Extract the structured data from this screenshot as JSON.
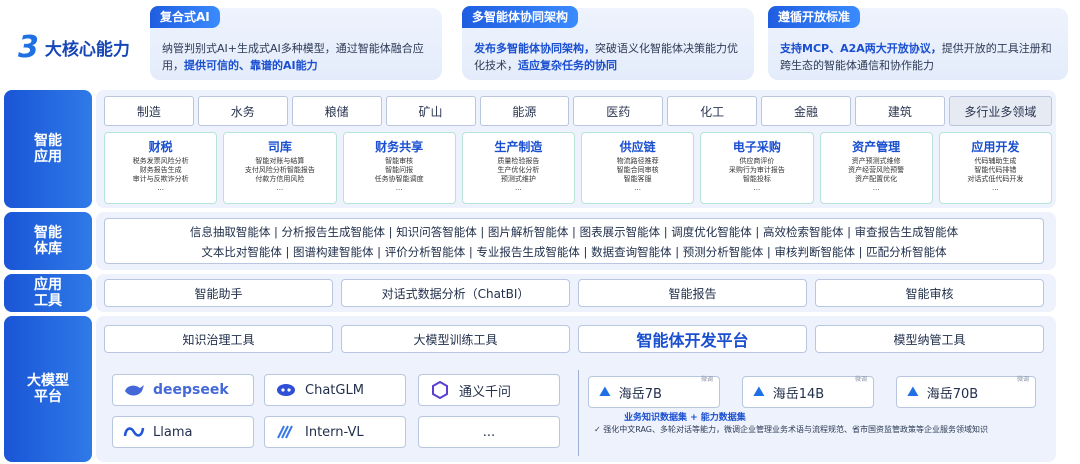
{
  "hero": {
    "number": "3",
    "label": "大核心能力"
  },
  "cards": [
    {
      "tag": "复合式AI",
      "body_plain": "纳管判别式AI+生成式AI多种模型，通过智能体融合应用，",
      "body_bold": "提供可信的、靠谱的AI能力"
    },
    {
      "tag": "多智能体协同架构",
      "body_bold_a": "发布多智能体协同架构，",
      "body_plain": "突破语义化智能体决策能力优化技术，",
      "body_bold_b": "适应复杂任务的协同"
    },
    {
      "tag": "遵循开放标准",
      "body_bold": "支持MCP、A2A两大开放协议，",
      "body_plain": "提供开放的工具注册和跨生态的智能体通信和协作能力"
    }
  ],
  "rails": {
    "smart_app": "智能\n应用",
    "agent_lib": "智能\n体库",
    "app_tools": "应用\n工具",
    "llm_platform": "大模型\n平台"
  },
  "industries": [
    "制造",
    "水务",
    "粮储",
    "矿山",
    "能源",
    "医药",
    "化工",
    "金融",
    "建筑",
    "多行业多领域"
  ],
  "scenarios": [
    {
      "title": "财税",
      "lines": [
        "税务发票风险分析",
        "财务报告生成",
        "审计与反欺诈分析",
        "..."
      ]
    },
    {
      "title": "司库",
      "lines": [
        "智能对账与结算",
        "支付风险分析智能报告",
        "付款方信用风险",
        "..."
      ]
    },
    {
      "title": "财务共享",
      "lines": [
        "智能审核",
        "智能问报",
        "任务协智能调度",
        "..."
      ]
    },
    {
      "title": "生产制造",
      "lines": [
        "质量检验报告",
        "生产优化分析",
        "预测式维护",
        "..."
      ]
    },
    {
      "title": "供应链",
      "lines": [
        "物流路径推荐",
        "智能合同审核",
        "智能客服",
        "..."
      ]
    },
    {
      "title": "电子采购",
      "lines": [
        "供应商评价",
        "采购行为审计报告",
        "智能投标",
        "..."
      ]
    },
    {
      "title": "资产管理",
      "lines": [
        "资产预测式维修",
        "资产经营风险预警",
        "资产配置优化",
        "..."
      ]
    },
    {
      "title": "应用开发",
      "lines": [
        "代码辅助生成",
        "智能代码排错",
        "对话式低代码开发",
        "..."
      ]
    }
  ],
  "agents": {
    "line1": "信息抽取智能体 | 分析报告生成智能体 | 知识问答智能体 | 图片解析智能体 | 图表展示智能体 | 调度优化智能体 | 高效检索智能体 | 审查报告生成智能体",
    "line2": "文本比对智能体 | 图谱构建智能体 | 评价分析智能体 | 专业报告生成智能体 | 数据查询智能体 | 预测分析智能体 | 审核判断智能体 | 匹配分析智能体"
  },
  "app_tools": [
    "智能助手",
    "对话式数据分析（ChatBI）",
    "智能报告",
    "智能审核"
  ],
  "platform_tools": [
    "知识治理工具",
    "大模型训练工具",
    "智能体开发平台",
    "模型纳管工具"
  ],
  "models": {
    "deepseek": "deepseek",
    "chatglm": "ChatGLM",
    "tongyi": "通义千问",
    "llama": "Llama",
    "internvl": "Intern-VL",
    "more": "..."
  },
  "haiyue": [
    {
      "name": "海岳7B",
      "tag": "微调"
    },
    {
      "name": "海岳14B",
      "tag": "微调"
    },
    {
      "name": "海岳70B",
      "tag": "微调"
    }
  ],
  "kb_title": "业务知识数据集 + 能力数据集",
  "kb_desc": "✓  强化中文RAG、多轮对话等能力，微调企业管理业务术语与流程规范、省市国资监管政策等企业服务领域知识",
  "colors": {
    "primary": "#1a55d6",
    "accent": "#1a4fd0",
    "panel": "#edf2fc",
    "scenario_border": "#b7e4d8"
  }
}
